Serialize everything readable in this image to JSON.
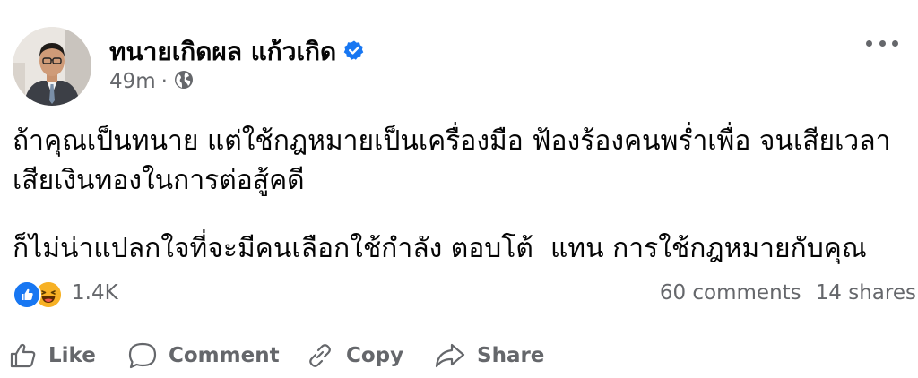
{
  "post": {
    "author_name": "ทนายเกิดผล แก้วเกิด",
    "time": "49m",
    "separator": "·",
    "audience_icon": "globe-icon",
    "verified_icon": "verified-badge-icon",
    "more_icon": "more-options-icon",
    "text_paragraph_1": "ถ้าคุณเป็นทนาย แต่ใช้กฎหมายเป็นเครื่องมือ ฟ้องร้องคนพร่ำเพื่อ จนเสียเวลา เสียเงินทองในการต่อสู้คดี",
    "text_paragraph_2": "ก็ไม่น่าแปลกใจที่จะมีคนเลือกใช้กำลัง ตอบโต้  แทน การใช้กฎหมายกับคุณ"
  },
  "stats": {
    "reaction_count": "1.4K",
    "reaction_icons": [
      "like-reaction-icon",
      "haha-reaction-icon"
    ],
    "comments": "60 comments",
    "shares": "14 shares"
  },
  "actions": {
    "like_label": "Like",
    "comment_label": "Comment",
    "copy_label": "Copy",
    "share_label": "Share"
  },
  "colors": {
    "brand_blue": "#1877f2",
    "secondary_text": "#65676b",
    "primary_text": "#050505",
    "haha_yellow": "#f7b125"
  }
}
